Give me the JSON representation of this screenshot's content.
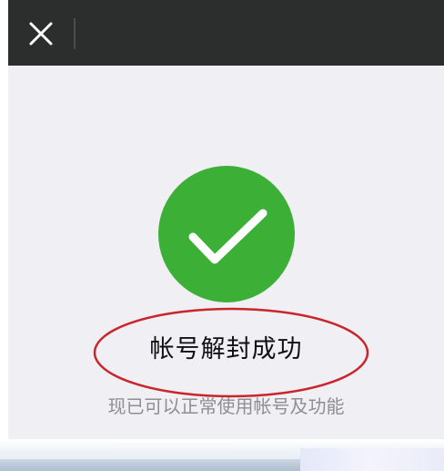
{
  "header": {
    "close_icon": "close-icon"
  },
  "status": {
    "icon": "checkmark-icon",
    "icon_color": "#3cb036",
    "title": "帐号解封成功",
    "subtitle": "现已可以正常使用帐号及功能"
  },
  "annotation": {
    "shape": "ellipse",
    "color": "#c8262c"
  }
}
